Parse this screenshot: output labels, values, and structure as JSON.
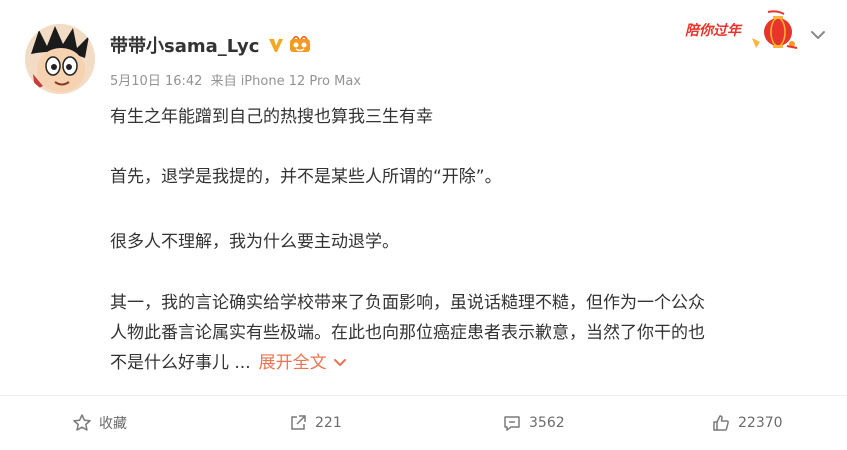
{
  "post": {
    "author": "带带小sama_Lyc",
    "date": "5月10日 16:42",
    "source": "来自 iPhone 12 Pro Max",
    "paragraphs": {
      "p1": "有生之年能蹭到自己的热搜也算我三生有幸",
      "p2": "首先，退学是我提的，并不是某些人所谓的“开除”。",
      "p3": "很多人不理解，我为什么要主动退学。",
      "p4_line1": "其一，我的言论确实给学校带来了负面影响，虽说话糙理不糙，但作为一个公众",
      "p4_line2": "人物此番言论属实有些极端。在此也向那位癌症患者表示歉意，当然了你干的也",
      "p4_line3": "不是什么好事儿 ..."
    },
    "expand_label": "展开全文"
  },
  "festival_badge": "陪你过年",
  "actions": {
    "favorite_label": "收藏",
    "forward_count": "221",
    "comment_count": "3562",
    "like_count": "22370"
  },
  "colors": {
    "accent_orange": "#eb7350",
    "verified_gold": "#f5a623",
    "festival_red": "#e8342a"
  }
}
